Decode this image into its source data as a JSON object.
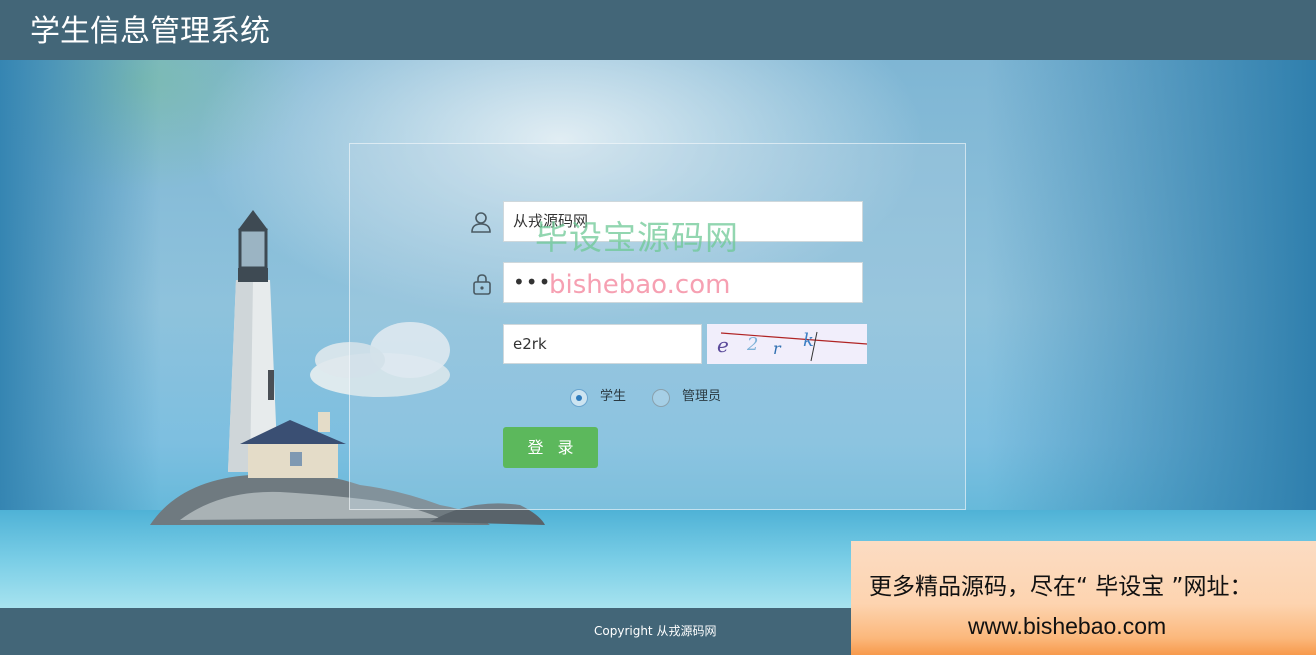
{
  "header": {
    "title": "学生信息管理系统"
  },
  "form": {
    "username": {
      "value": "从戎源码网",
      "icon": "user-icon"
    },
    "password": {
      "value": "•••",
      "icon": "lock-icon"
    },
    "captcha": {
      "value": "e2rk",
      "image_text": "e 2 r k"
    },
    "roles": [
      {
        "label": "学生",
        "checked": true
      },
      {
        "label": "管理员",
        "checked": false
      }
    ],
    "login_label": "登录"
  },
  "watermark": {
    "cn": "毕设宝源码网",
    "en": "bishebao.com"
  },
  "footer": {
    "copyright": "Copyright   从戎源码网"
  },
  "promo": {
    "line1": "更多精品源码，尽在“ 毕设宝 ”网址：",
    "line2": "www.bishebao.com"
  },
  "colors": {
    "header_bg": "#436678",
    "login_button": "#5cb85c",
    "radio_selected": "#2e7bbd"
  }
}
